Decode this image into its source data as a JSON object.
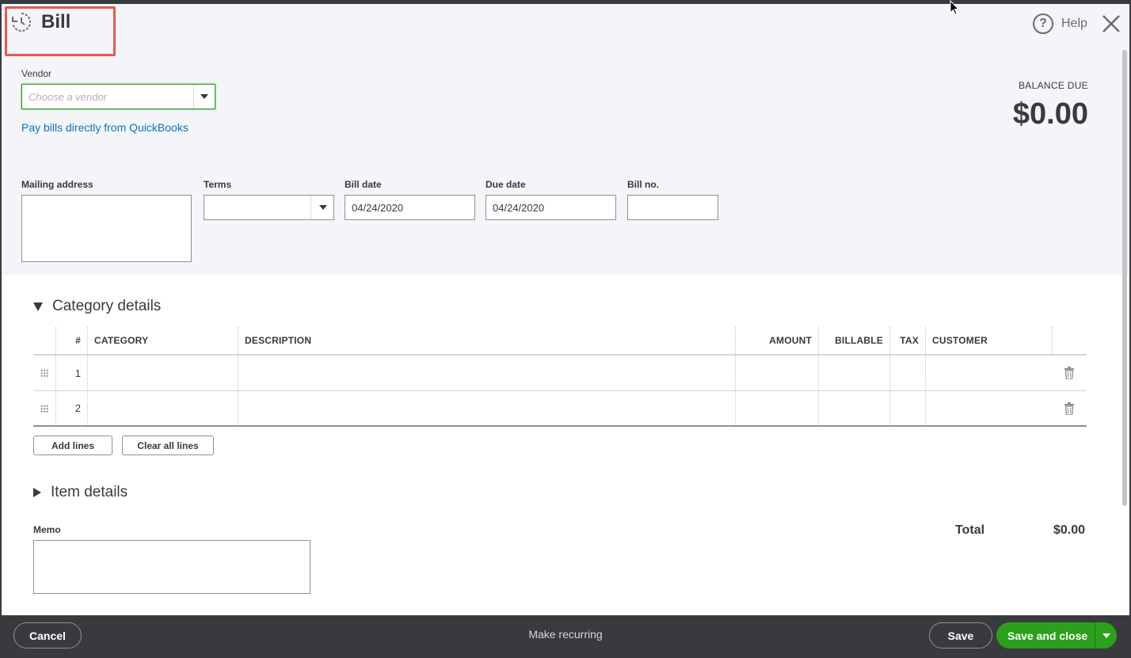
{
  "header": {
    "title": "Bill",
    "help_label": "Help"
  },
  "vendor": {
    "label": "Vendor",
    "placeholder": "Choose a vendor",
    "pay_link": "Pay bills directly from QuickBooks"
  },
  "balance": {
    "label": "BALANCE DUE",
    "value": "$0.00"
  },
  "fields": {
    "mailing_address_label": "Mailing address",
    "terms_label": "Terms",
    "terms_value": "",
    "bill_date_label": "Bill date",
    "bill_date_value": "04/24/2020",
    "due_date_label": "Due date",
    "due_date_value": "04/24/2020",
    "bill_no_label": "Bill no.",
    "bill_no_value": ""
  },
  "category_details": {
    "title": "Category details",
    "columns": {
      "num": "#",
      "category": "CATEGORY",
      "description": "DESCRIPTION",
      "amount": "AMOUNT",
      "billable": "BILLABLE",
      "tax": "TAX",
      "customer": "CUSTOMER"
    },
    "rows": [
      "1",
      "2"
    ],
    "add_lines": "Add lines",
    "clear_all_lines": "Clear all lines"
  },
  "item_details": {
    "title": "Item details"
  },
  "memo": {
    "label": "Memo"
  },
  "total": {
    "label": "Total",
    "value": "$0.00"
  },
  "footer": {
    "cancel": "Cancel",
    "make_recurring": "Make recurring",
    "save": "Save",
    "save_and_close": "Save and close"
  },
  "colors": {
    "accent_green": "#2ca01c",
    "link_blue": "#0077c5",
    "highlight_red": "#e55b4f",
    "footer_bg": "#393a3d"
  }
}
